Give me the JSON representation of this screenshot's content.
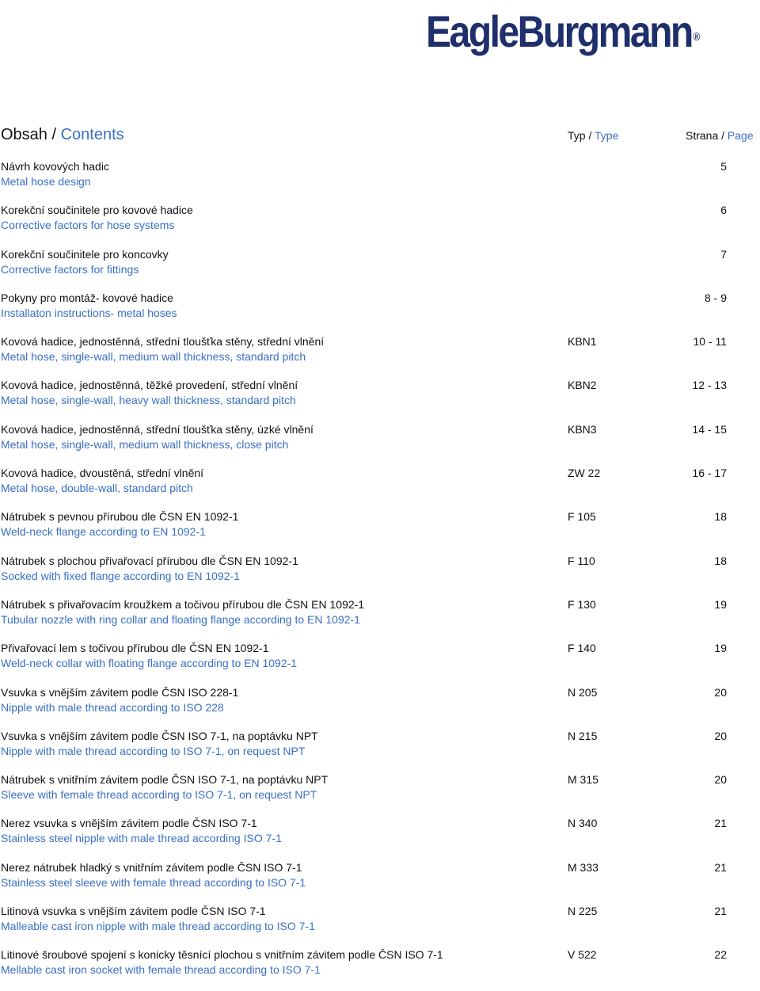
{
  "logo": {
    "text": "EagleBurgmann",
    "registered": "®",
    "color": "#1f2f6b"
  },
  "header": {
    "title_cz": "Obsah /",
    "title_en": "Contents",
    "type_cz": "Typ /",
    "type_en": "Type",
    "page_cz": "Strana /",
    "page_en": "Page"
  },
  "accent_color": "#3a6fc4",
  "entries": [
    {
      "cz": "Návrh kovových hadic",
      "en": "Metal hose design",
      "type": "",
      "page": "5"
    },
    {
      "cz": "Korekční součinitele pro kovové hadice",
      "en": "Corrective factors for hose systems",
      "type": "",
      "page": "6"
    },
    {
      "cz": "Korekční součinitele pro koncovky",
      "en": "Corrective factors for fittings",
      "type": "",
      "page": "7"
    },
    {
      "cz": "Pokyny pro montáž- kovové hadice",
      "en": "Installaton instructions- metal hoses",
      "type": "",
      "page": "8 - 9"
    },
    {
      "cz": "Kovová hadice, jednostěnná, střední tloušťka stěny, střední vlnění",
      "en": "Metal hose, single-wall, medium wall thickness, standard pitch",
      "type": "KBN1",
      "page": "10 - 11"
    },
    {
      "cz": "Kovová hadice, jednostěnná, těžké provedení, střední vlnění",
      "en": "Metal hose, single-wall, heavy wall thickness, standard pitch",
      "type": "KBN2",
      "page": "12 - 13"
    },
    {
      "cz": "Kovová hadice, jednostěnná, střední tloušťka stěny, úzké vlnění",
      "en": "Metal hose, single-wall, medium wall thickness, close pitch",
      "type": "KBN3",
      "page": "14 - 15"
    },
    {
      "cz": "Kovová hadice, dvoustěná, střední vlnění",
      "en": "Metal hose, double-wall, standard pitch",
      "type": "ZW 22",
      "page": "16 - 17"
    },
    {
      "cz": "Nátrubek s pevnou přírubou dle ČSN EN 1092-1",
      "en": "Weld-neck flange according to EN 1092-1",
      "type": "F 105",
      "page": "18"
    },
    {
      "cz": "Nátrubek s plochou přivařovací přírubou dle ČSN EN 1092-1",
      "en": "Socked with fixed flange according to EN 1092-1",
      "type": "F 110",
      "page": "18"
    },
    {
      "cz": "Nátrubek s přivařovacím kroužkem a točivou přírubou dle ČSN EN 1092-1",
      "en": "Tubular nozzle with ring collar and floating flange according to EN 1092-1",
      "type": "F 130",
      "page": "19"
    },
    {
      "cz": "Přivařovací lem s točivou přírubou dle ČSN EN 1092-1",
      "en": "Weld-neck collar with floating flange according to EN 1092-1",
      "type": "F 140",
      "page": "19"
    },
    {
      "cz": "Vsuvka s vnějším závitem podle ČSN ISO 228-1",
      "en": "Nipple with male thread according to ISO 228",
      "type": "N 205",
      "page": "20"
    },
    {
      "cz": "Vsuvka s vnějším závitem podle ČSN ISO 7-1, na poptávku NPT",
      "en": "Nipple with male thread according to ISO 7-1, on request NPT",
      "type": "N 215",
      "page": "20"
    },
    {
      "cz": "Nátrubek s vnitřním závitem podle ČSN ISO 7-1, na poptávku NPT",
      "en": "Sleeve with female thread according to ISO 7-1, on request NPT",
      "type": "M 315",
      "page": "20"
    },
    {
      "cz": "Nerez vsuvka s vnějším závitem podle ČSN ISO 7-1",
      "en": "Stainless steel nipple with male thread according ISO 7-1",
      "type": "N 340",
      "page": "21"
    },
    {
      "cz": "Nerez nátrubek hladký s vnitřním závitem podle ČSN ISO 7-1",
      "en": "Stainless steel sleeve with female thread according to ISO 7-1",
      "type": "M 333",
      "page": "21"
    },
    {
      "cz": "Litinová vsuvka s vnějším závitem podle ČSN ISO 7-1",
      "en": "Malleable cast iron nipple with male thread according to ISO 7-1",
      "type": "N 225",
      "page": "21"
    },
    {
      "cz": "Litinové šroubové spojení s konicky těsnící plochou s vnitřním závitem podle ČSN ISO 7-1",
      "en": "Mellable cast iron socket with female thread according to ISO 7-1",
      "type": "V 522",
      "page": "22"
    }
  ]
}
